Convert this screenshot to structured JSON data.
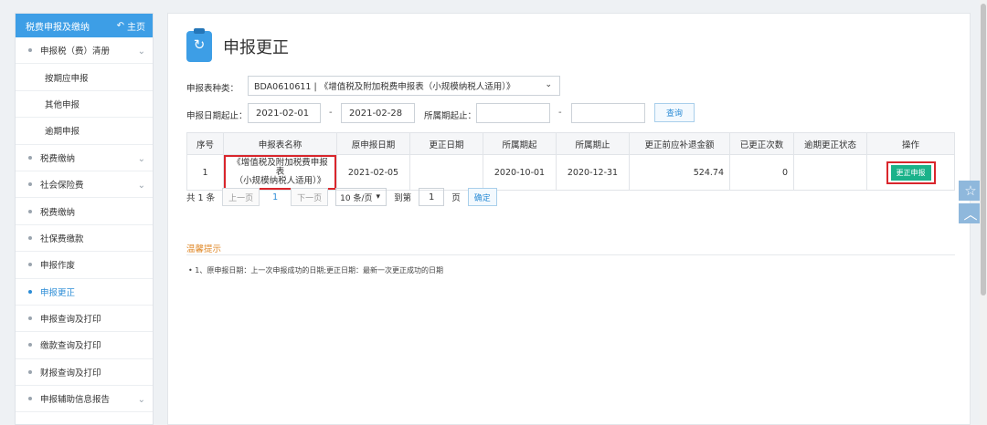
{
  "sidebar": {
    "header_title": "税费申报及缴纳",
    "home_label": "主页",
    "items": [
      {
        "label": "申报税（费）清册",
        "expandable": true,
        "level": 1
      },
      {
        "label": "按期应申报",
        "expandable": false,
        "level": 2
      },
      {
        "label": "其他申报",
        "expandable": false,
        "level": 2
      },
      {
        "label": "逾期申报",
        "expandable": false,
        "level": 2
      },
      {
        "label": "税费缴纳",
        "expandable": true,
        "level": 1
      },
      {
        "label": "社会保险费",
        "expandable": true,
        "level": 1
      },
      {
        "label": "税费缴纳",
        "expandable": false,
        "level": 1
      },
      {
        "label": "社保费缴款",
        "expandable": false,
        "level": 1
      },
      {
        "label": "申报作废",
        "expandable": false,
        "level": 1
      },
      {
        "label": "申报更正",
        "expandable": false,
        "level": 1,
        "active": true
      },
      {
        "label": "申报查询及打印",
        "expandable": false,
        "level": 1
      },
      {
        "label": "缴款查询及打印",
        "expandable": false,
        "level": 1
      },
      {
        "label": "财报查询及打印",
        "expandable": false,
        "level": 1
      },
      {
        "label": "申报辅助信息报告",
        "expandable": true,
        "level": 1
      }
    ]
  },
  "page": {
    "title": "申报更正",
    "form": {
      "type_label": "申报表种类：",
      "type_value": "BDA0610611 | 《增值税及附加税费申报表（小规模纳税人适用）》",
      "date_label": "申报日期起止：",
      "date_from": "2021-02-01",
      "date_to": "2021-02-28",
      "period_label": "所属期起止：",
      "period_from": "",
      "period_to": "",
      "dash": "-",
      "query_label": "查询"
    },
    "table": {
      "headers": [
        "序号",
        "申报表名称",
        "原申报日期",
        "更正日期",
        "所属期起",
        "所属期止",
        "更正前应补退金额",
        "已更正次数",
        "逾期更正状态",
        "操作"
      ],
      "rows": [
        {
          "index": "1",
          "name_line1": "《增值税及附加税费申报表",
          "name_line2": "（小规模纳税人适用）》",
          "orig_date": "2021-02-05",
          "corr_date": "",
          "period_start": "2020-10-01",
          "period_end": "2020-12-31",
          "amount": "524.74",
          "count": "0",
          "overdue_status": "",
          "action_label": "更正申报"
        }
      ]
    },
    "pager": {
      "total": "共 1 条",
      "prev": "上一页",
      "page": "1",
      "next": "下一页",
      "size": "10 条/页",
      "goto": "到第",
      "goto_value": "1",
      "page_unit": "页",
      "confirm": "确定"
    },
    "tips": {
      "title": "温馨提示",
      "text": "•  1、原申报日期：上一次申报成功的日期;更正日期：最新一次更正成功的日期"
    }
  },
  "float_buttons": [
    {
      "icon": "star-icon"
    },
    {
      "icon": "chevron-up-icon"
    }
  ]
}
